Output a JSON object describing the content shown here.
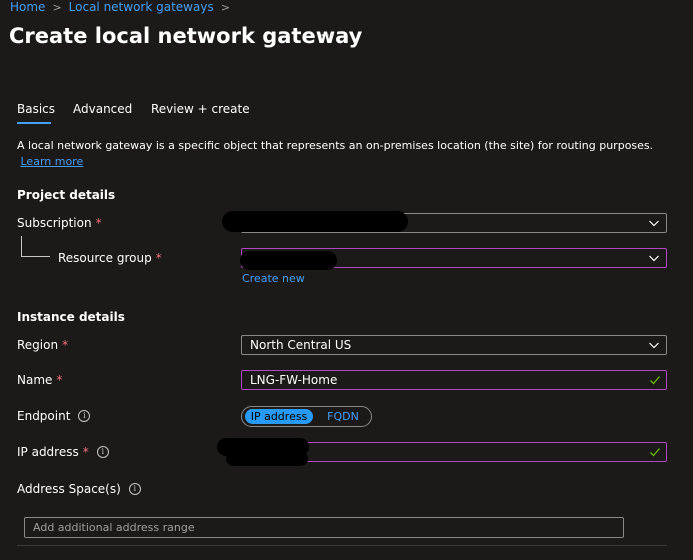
{
  "breadcrumb": {
    "home": "Home",
    "sep": ">",
    "parent": "Local network gateways"
  },
  "page": {
    "title": "Create local network gateway",
    "more": "···"
  },
  "tabs": [
    {
      "label": "Basics"
    },
    {
      "label": "Advanced"
    },
    {
      "label": "Review + create"
    }
  ],
  "description": {
    "text": "A local network gateway is a specific object that represents an on-premises location (the site) for routing purposes.",
    "link": "Learn more"
  },
  "project_details": {
    "heading": "Project details",
    "subscription_label": "Subscription",
    "resource_group_label": "Resource group",
    "create_new": "Create new"
  },
  "instance_details": {
    "heading": "Instance details",
    "region_label": "Region",
    "region_value": "North Central US",
    "name_label": "Name",
    "name_value": "LNG-FW-Home",
    "endpoint_label": "Endpoint",
    "endpoint_options": [
      "IP address",
      "FQDN"
    ],
    "ip_label": "IP address",
    "address_space_label": "Address Space(s)",
    "address_placeholder": "Add additional address range"
  },
  "required_mark": "*",
  "info_glyph": "i",
  "colors": {
    "background": "#1b1a19",
    "link": "#479ef5",
    "required": "#f1707b",
    "focus_border": "#b146c2",
    "toggle_active": "#2899f5",
    "valid_check": "#6bb700"
  }
}
